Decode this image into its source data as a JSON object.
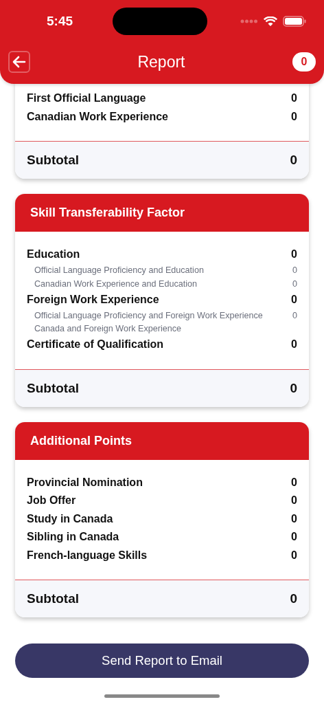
{
  "status_bar": {
    "time": "5:45"
  },
  "header": {
    "title": "Report",
    "badge": "0"
  },
  "sections": [
    {
      "rows": [
        {
          "label": "First Official Language",
          "value": "0"
        },
        {
          "label": "Canadian Work Experience",
          "value": "0"
        }
      ],
      "subtotal": {
        "label": "Subtotal",
        "value": "0"
      }
    },
    {
      "title": "Skill Transferability Factor",
      "rows": [
        {
          "label": "Education",
          "value": "0",
          "children": [
            {
              "label": "Official Language Proficiency and Education",
              "value": "0"
            },
            {
              "label": "Canadian Work Experience and Education",
              "value": "0"
            }
          ]
        },
        {
          "label": "Foreign Work Experience",
          "value": "0",
          "children": [
            {
              "label": "Official Language Proficiency and Foreign Work Experience",
              "value": "0"
            },
            {
              "label": "Canada and Foreign Work Experience"
            }
          ]
        },
        {
          "label": "Certificate of Qualification",
          "value": "0"
        }
      ],
      "subtotal": {
        "label": "Subtotal",
        "value": "0"
      }
    },
    {
      "title": "Additional Points",
      "rows": [
        {
          "label": "Provincial Nomination",
          "value": "0"
        },
        {
          "label": "Job Offer",
          "value": "0"
        },
        {
          "label": "Study in Canada",
          "value": "0"
        },
        {
          "label": "Sibling in Canada",
          "value": "0"
        },
        {
          "label": "French-language Skills",
          "value": "0"
        }
      ],
      "subtotal": {
        "label": "Subtotal",
        "value": "0"
      }
    }
  ],
  "button": {
    "label": "Send Report to Email"
  }
}
